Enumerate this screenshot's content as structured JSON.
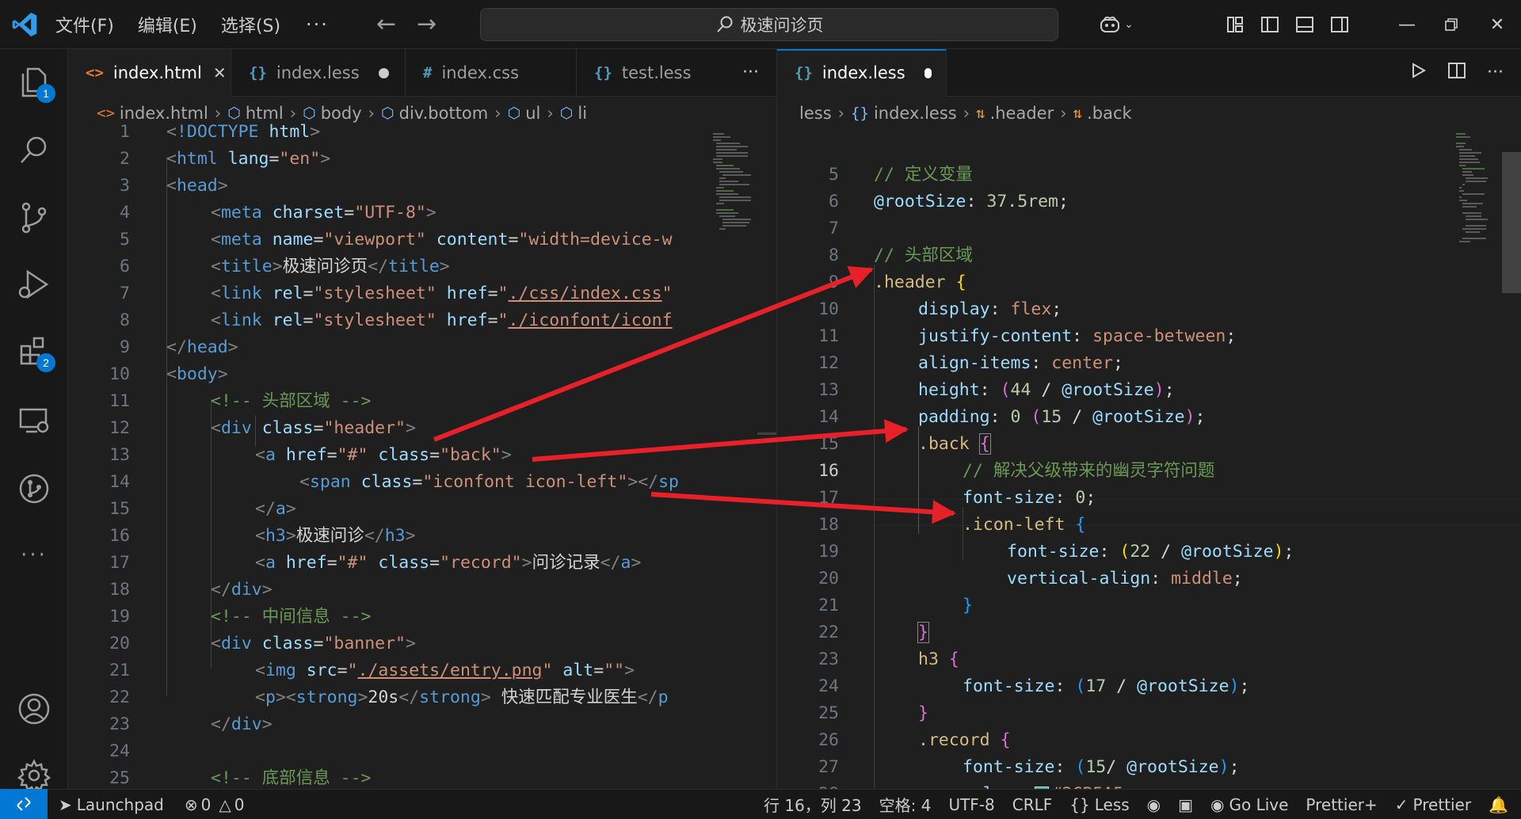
{
  "titlebar": {
    "menus": [
      "文件(F)",
      "编辑(E)",
      "选择(S)"
    ],
    "more": "···",
    "search": "极速问诊页"
  },
  "activity": {
    "explorer_badge": "1",
    "extensions_badge": "2"
  },
  "left": {
    "tabs": [
      {
        "icon": "<>",
        "label": "index.html",
        "active": true
      },
      {
        "icon": "{}",
        "label": "index.less",
        "dirty": true
      },
      {
        "icon": "#",
        "label": "index.css"
      },
      {
        "icon": "{}",
        "label": "test.less"
      }
    ],
    "more": "···",
    "breadcrumb": [
      "index.html",
      "html",
      "body",
      "div.bottom",
      "ul",
      "li"
    ]
  },
  "right": {
    "tabs": [
      {
        "icon": "{}",
        "label": "index.less",
        "dirty": true
      }
    ],
    "breadcrumb": [
      "less",
      "index.less",
      ".header",
      ".back"
    ]
  },
  "colors": {
    "accent": "#0078d4",
    "swatch": "#2CB5A5",
    "arrow": "#e8202a"
  },
  "status": {
    "remote_icon": "remote-icon",
    "launchpad": "Launchpad",
    "errors": "0",
    "warnings": "0",
    "position": "行 16，列 23",
    "spaces": "空格: 4",
    "encoding": "UTF-8",
    "eol": "CRLF",
    "language": "Less",
    "golive": "Go Live",
    "prettier_plus": "Prettier+",
    "prettier": "Prettier"
  }
}
